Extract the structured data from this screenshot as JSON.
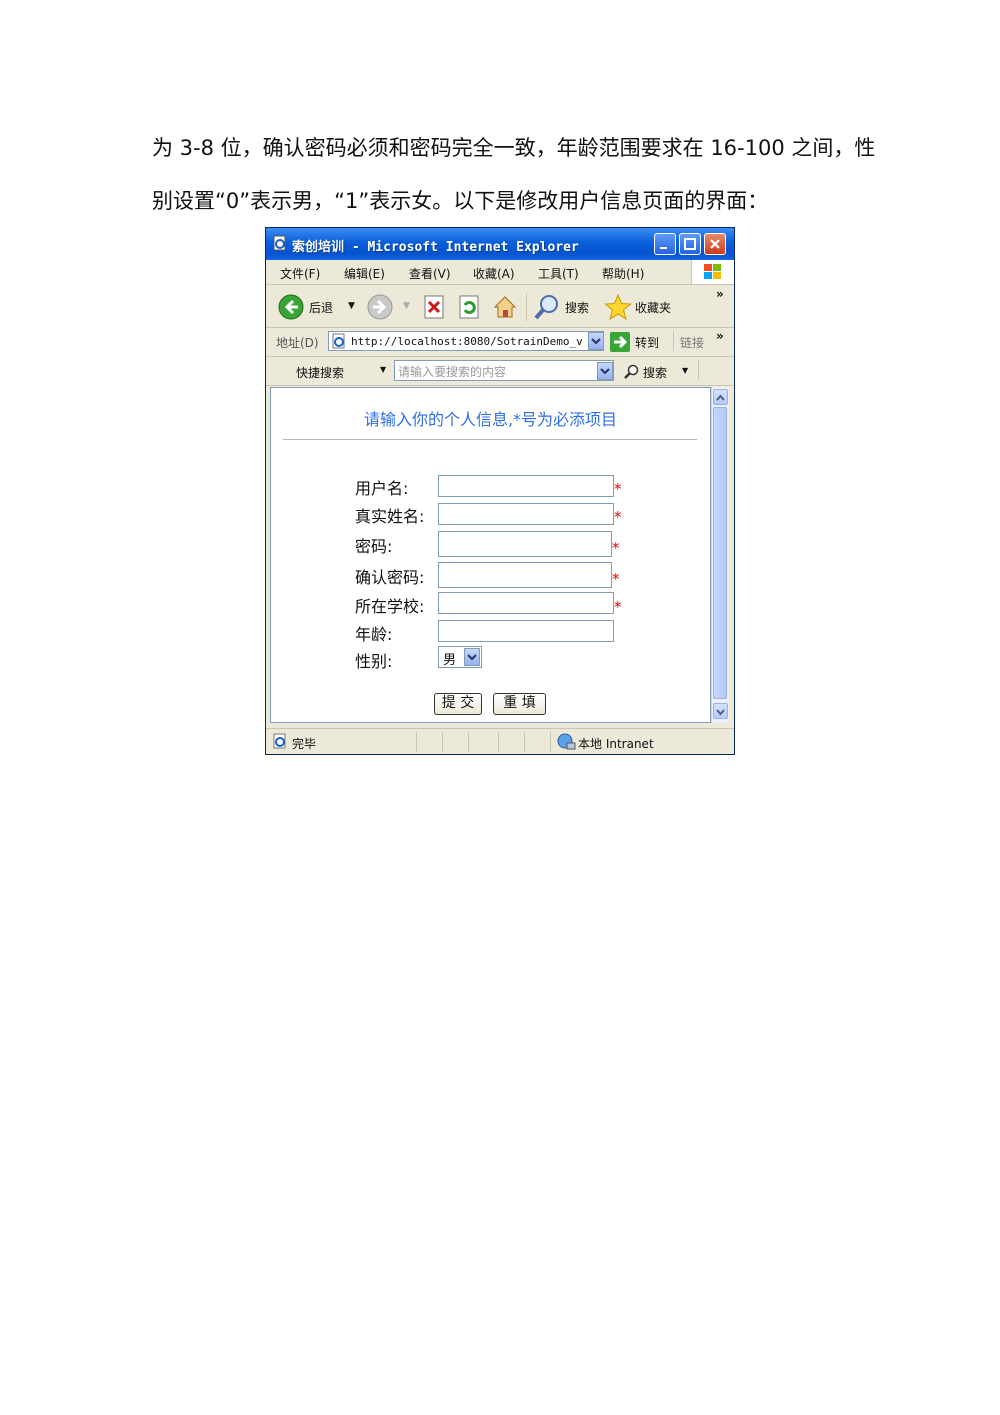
{
  "paragraph": {
    "line1": "为 3-8 位，确认密码必须和密码完全一致，年龄范围要求在 16-100 之间，性",
    "line2": "别设置“0”表示男，“1”表示女。以下是修改用户信息页面的界面："
  },
  "window": {
    "title": "索创培训 - Microsoft Internet Explorer",
    "menu": [
      "文件(F)",
      "编辑(E)",
      "查看(V)",
      "收藏(A)",
      "工具(T)",
      "帮助(H)"
    ],
    "toolbar": {
      "back": "后退",
      "search": "搜索",
      "favorites": "收藏夹",
      "more": "»"
    },
    "address": {
      "label": "地址(D)",
      "url": "http://localhost:8080/SotrainDemo_v",
      "go": "转到",
      "links": "链接",
      "more": "»"
    },
    "search_bar": {
      "label": "快捷搜索",
      "placeholder": "请输入要搜索的内容",
      "button": "搜索"
    },
    "status": {
      "text": "完毕",
      "zone": "本地 Intranet"
    }
  },
  "form": {
    "heading": "请输入你的个人信息,*号为必添项目",
    "fields": [
      {
        "label": "用户名:",
        "required": "*"
      },
      {
        "label": "真实姓名:",
        "required": "*"
      },
      {
        "label": "密码:",
        "required": "*"
      },
      {
        "label": "确认密码:",
        "required": "*"
      },
      {
        "label": "所在学校:",
        "required": "*"
      },
      {
        "label": "年龄:",
        "required": ""
      },
      {
        "label": "性别:",
        "required": ""
      }
    ],
    "gender_selected": "男",
    "submit": "提 交",
    "reset": "重 填"
  },
  "colors": {
    "title_bar": "#0a5fd8",
    "heading": "#2f6ee5",
    "required_star": "#e00000"
  }
}
